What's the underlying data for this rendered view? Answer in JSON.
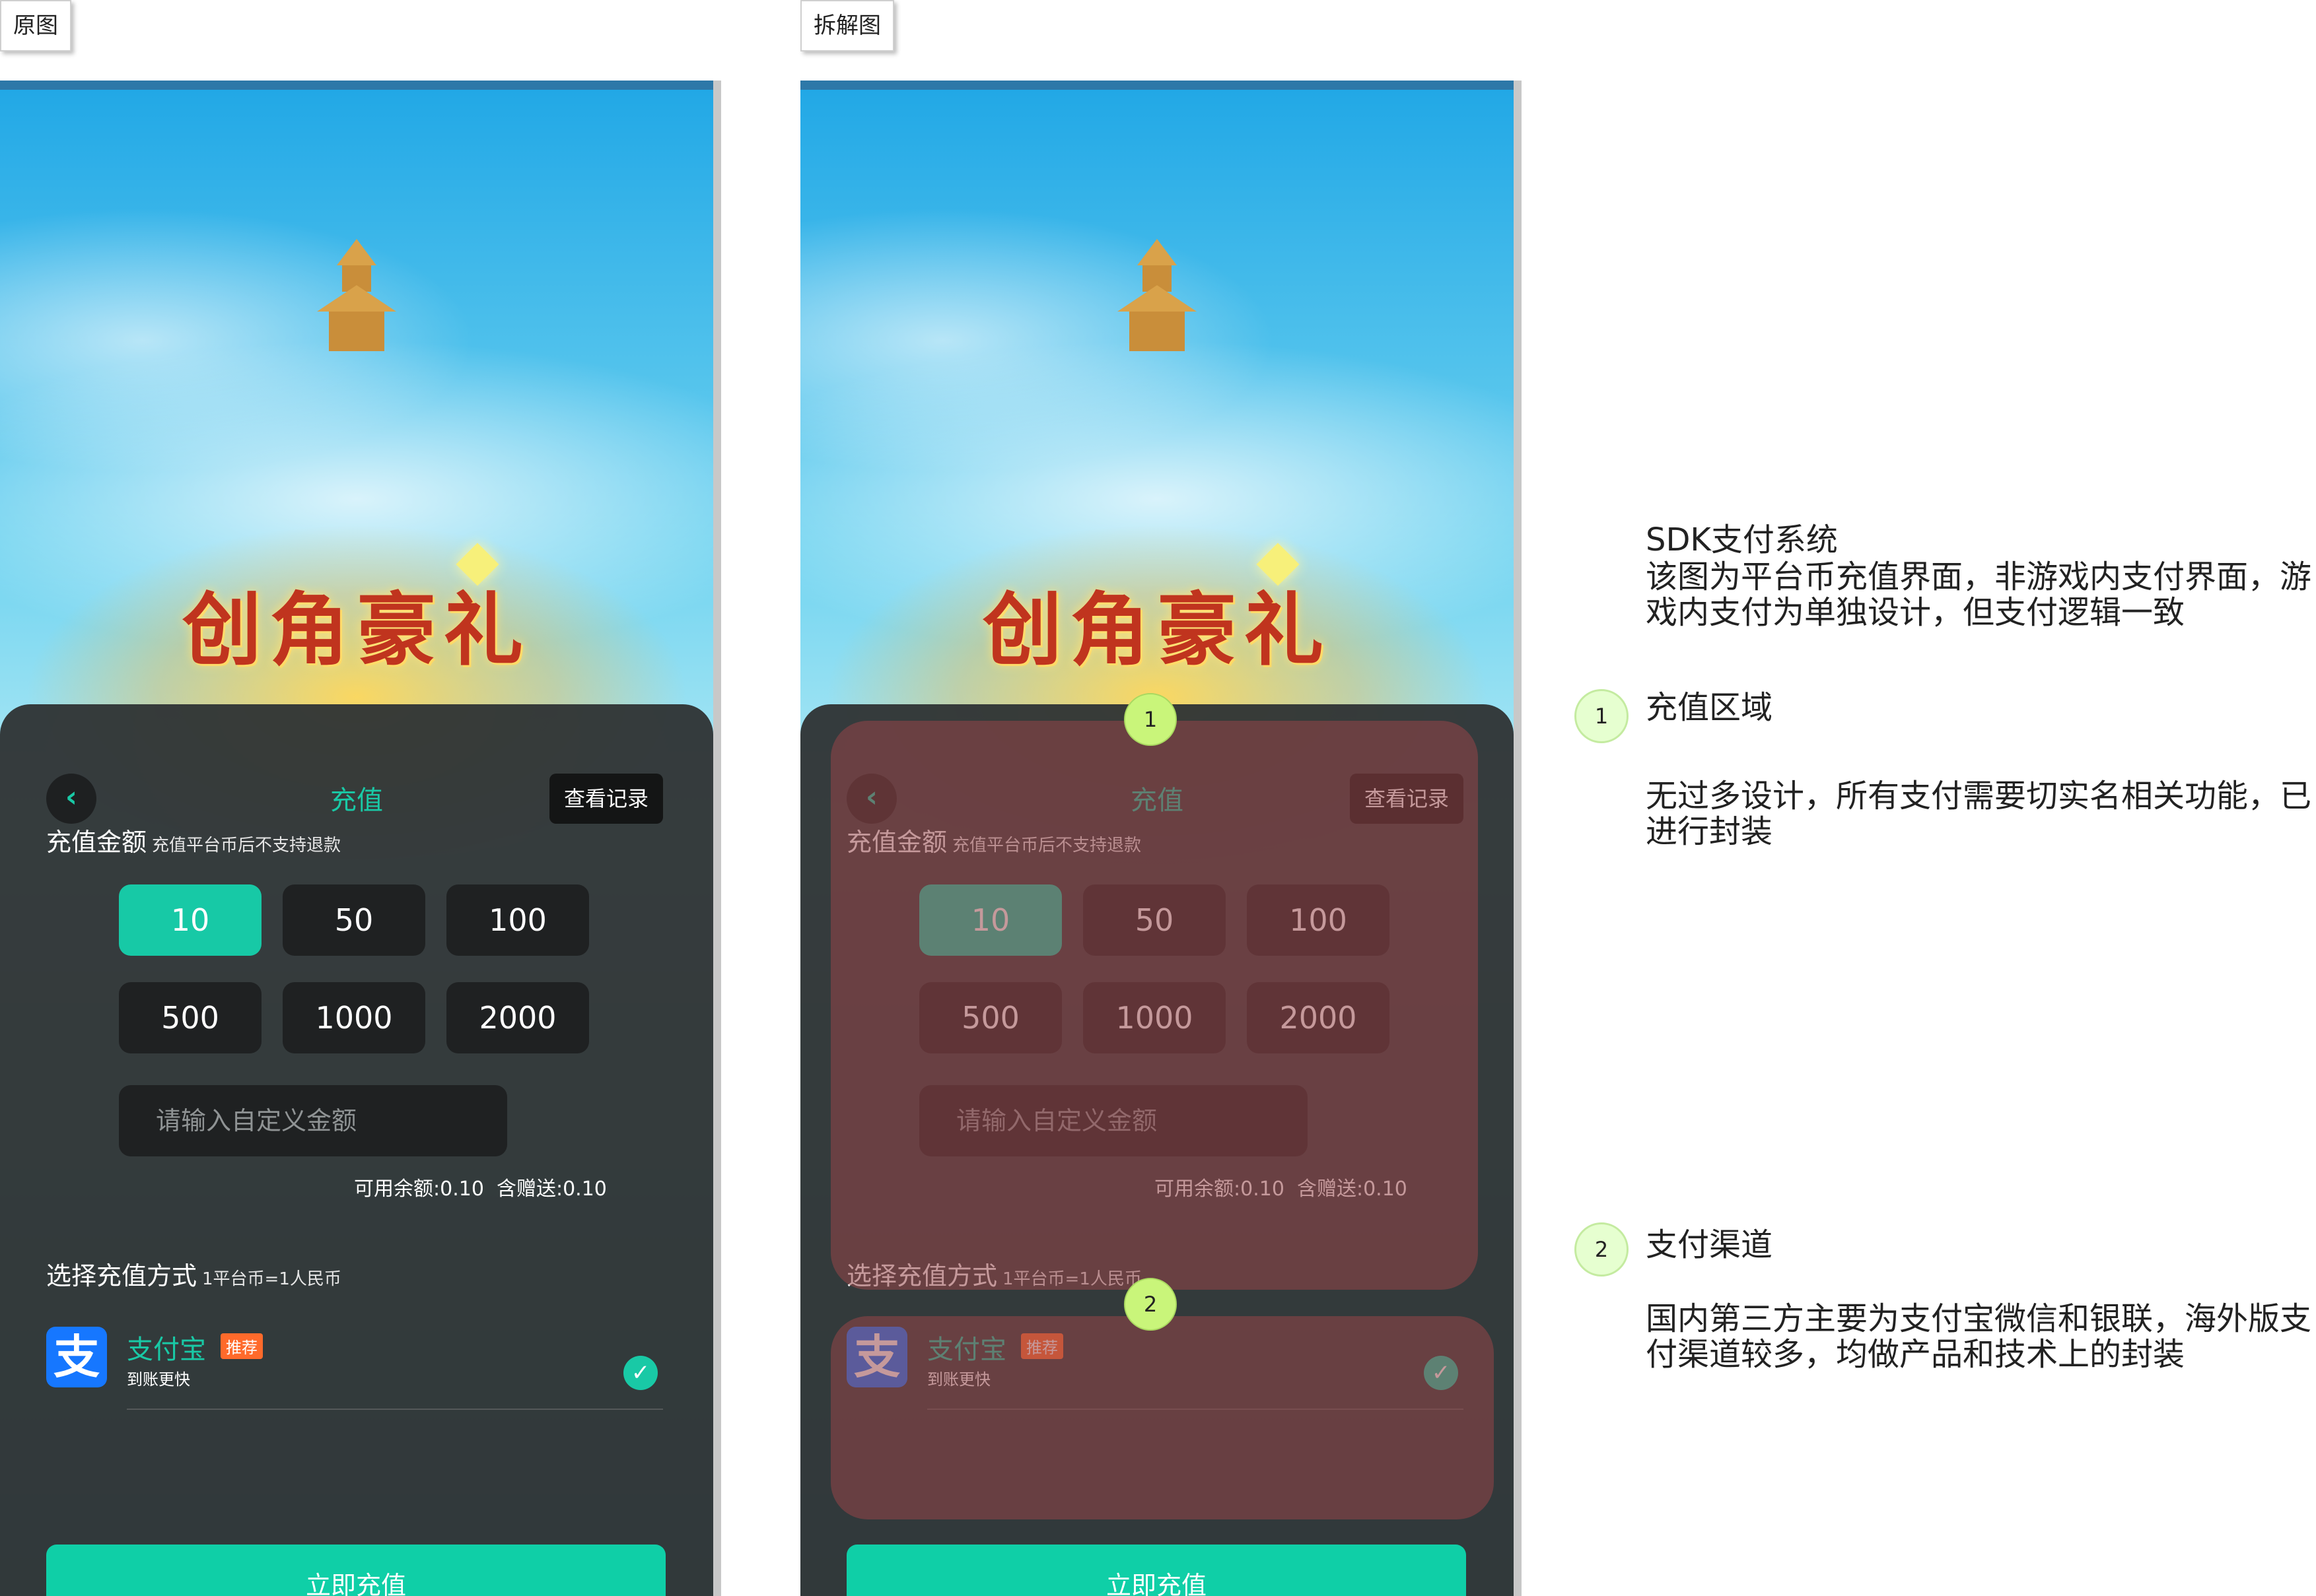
{
  "labels": {
    "left": "原图",
    "right": "拆解图"
  },
  "game": {
    "banner_title": "创角豪礼"
  },
  "recharge": {
    "title": "充值",
    "record_button": "查看记录",
    "amount_label": "充值金额",
    "amount_note": "充值平台币后不支持退款",
    "amounts": [
      "10",
      "50",
      "100",
      "500",
      "1000",
      "2000"
    ],
    "selected_amount": "10",
    "custom_placeholder": "请输入自定义金额",
    "balance": "可用余额:0.10",
    "bonus": "含赠送:0.10",
    "method_label": "选择充值方式",
    "method_rate": "1平台币=1人民币",
    "alipay_name": "支付宝",
    "alipay_badge": "推荐",
    "alipay_sub": "到账更快",
    "pay_button": "立即充值"
  },
  "colors": {
    "accent": "#17c9a6",
    "panel": "#303435",
    "highlight": "#964648",
    "marker": "#c9f57a"
  },
  "notes": {
    "header": "SDK支付系统",
    "header_line1": "该图为平台币充值界面，非游戏内支付界面，游",
    "header_line2": "戏内支付为单独设计，但支付逻辑一致",
    "item1_no": "1",
    "item1_title": "充值区域",
    "item1_line1": "无过多设计，所有支付需要切实名相关功能，已",
    "item1_line2": "进行封装",
    "item2_no": "2",
    "item2_title": "支付渠道",
    "item2_line1": "国内第三方主要为支付宝微信和银联，海外版支",
    "item2_line2": "付渠道较多，均做产品和技术上的封装"
  }
}
